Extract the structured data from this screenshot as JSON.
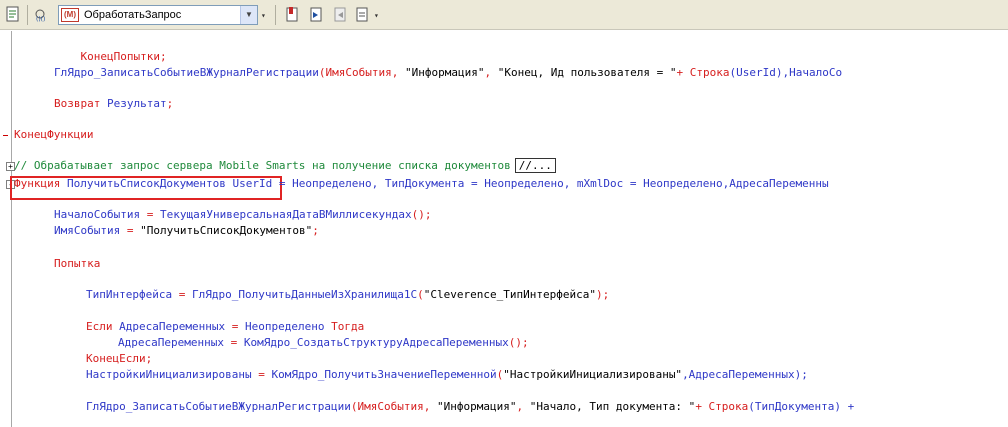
{
  "toolbar": {
    "procedure_select": "ОбработатьЗапрос",
    "procedure_icon_text": "(M)"
  },
  "code": {
    "l1": "КонецПопытки;",
    "l2_fn": "ГлЯдро_ЗаписатьСобытиеВЖурналРегистрации",
    "l2_a": "(ИмяСобытия, ",
    "l2_s1": "\"Информация\"",
    "l2_b": ", ",
    "l2_s2": "\"Конец, Ид пользователя = \"",
    "l2_c": "+ Строка",
    "l2_d": "(UserId),НачалоСо",
    "l3_kw": "Возврат",
    "l3_id": " Результат",
    "l3_end": ";",
    "l4": "КонецФункции",
    "l5_comment": "// Обрабатывает запрос сервера Mobile Smarts на получение списка документов",
    "l5_box": "//...",
    "l6_kw": "Функция ",
    "l6_name": "ПолучитьСписокДокументов",
    "l6_params": " UserId = Неопределено, ТипДокумента = Неопределено, mXmlDoc = Неопределено,АдресаПеременны",
    "l7_a": "НачалоСобытия",
    "l7_b": " = ",
    "l7_c": "ТекущаяУниверсальнаяДатаВМиллисекундах",
    "l7_d": "();",
    "l8_a": "ИмяСобытия",
    "l8_b": " = ",
    "l8_s": "\"ПолучитьСписокДокументов\"",
    "l8_d": ";",
    "l9": "Попытка",
    "l10_a": "ТипИнтерфейса",
    "l10_b": " = ",
    "l10_c": "ГлЯдро_ПолучитьДанныеИзХранилища1С",
    "l10_d": "(",
    "l10_s": "\"Cleverence_ТипИнтерфейса\"",
    "l10_e": ");",
    "l11_kw": "Если ",
    "l11_a": "АдресаПеременных",
    "l11_b": " = ",
    "l11_c": "Неопределено",
    "l11_kw2": " Тогда",
    "l12_a": "АдресаПеременных",
    "l12_b": " = ",
    "l12_c": "КомЯдро_СоздатьСтруктуруАдресаПеременных",
    "l12_d": "();",
    "l13": "КонецЕсли;",
    "l14_a": "НастройкиИнициализированы",
    "l14_b": " = ",
    "l14_c": "КомЯдро_ПолучитьЗначениеПеременной",
    "l14_d": "(",
    "l14_s": "\"НастройкиИнициализированы\"",
    "l14_e": ",АдресаПеременных);",
    "l15_fn": "ГлЯдро_ЗаписатьСобытиеВЖурналРегистрации",
    "l15_a": "(ИмяСобытия, ",
    "l15_s1": "\"Информация\"",
    "l15_b": ", ",
    "l15_s2": "\"Начало, Тип документа: \"",
    "l15_c": "+ Строка",
    "l15_d": "(ТипДокумента) +"
  }
}
